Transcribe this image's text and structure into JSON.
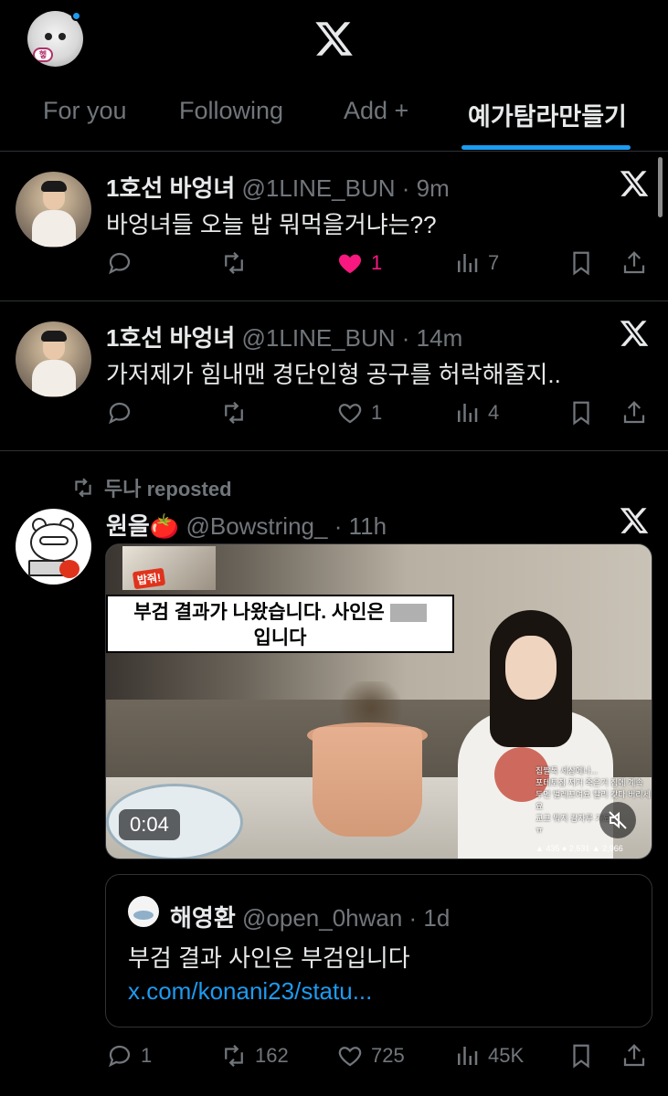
{
  "header": {
    "logo_icon": "x-logo-icon",
    "avatar_tag": "헿",
    "tabs": [
      {
        "label": "For you",
        "active": false
      },
      {
        "label": "Following",
        "active": false
      },
      {
        "label": "Add +",
        "active": false
      },
      {
        "label": "예가탐라만들기",
        "active": true
      }
    ]
  },
  "colors": {
    "accent": "#1d9bf0",
    "like": "#f91880",
    "muted": "#71767b",
    "background": "#000000"
  },
  "tweets": [
    {
      "name": "1호선 바엉녀",
      "handle": "@1LINE_BUN",
      "time": "9m",
      "text": "바엉녀들 오늘 밥 뭐먹을거냐는??",
      "replies": "",
      "reposts": "",
      "likes": "1",
      "liked": true,
      "views": "7"
    },
    {
      "name": "1호선 바엉녀",
      "handle": "@1LINE_BUN",
      "time": "14m",
      "text": "가저제가 힘내맨 경단인형 공구를 허락해줄지..",
      "replies": "",
      "reposts": "",
      "likes": "1",
      "liked": false,
      "views": "4"
    },
    {
      "reposted_by": "두나 reposted",
      "name": "원을🍅",
      "handle": "@Bowstring_",
      "time": "11h",
      "video": {
        "caption_line1": "부검 결과가 나왔습니다. 사인은",
        "caption_line2": "입니다",
        "cat_tag": "밥줘!",
        "duration": "0:04",
        "chat_lines": [
          "집짤톡 세상에나...",
          "포테토칩 저거 죽은거 집에 계속 두면 벌레꼬여요 빨리 갖다 버리세요",
          "교교 뭐지 감자루 가요?",
          "ㅠ"
        ],
        "stats": "▲ 435   ● 2,531   ▲ 2,966"
      },
      "quote": {
        "name": "해영환",
        "handle": "@open_0hwan",
        "time": "1d",
        "text": "부검 결과 사인은 부검입니다 ",
        "link": "x.com/konani23/statu..."
      },
      "replies": "1",
      "reposts": "162",
      "likes": "725",
      "liked": false,
      "views": "45K"
    }
  ]
}
